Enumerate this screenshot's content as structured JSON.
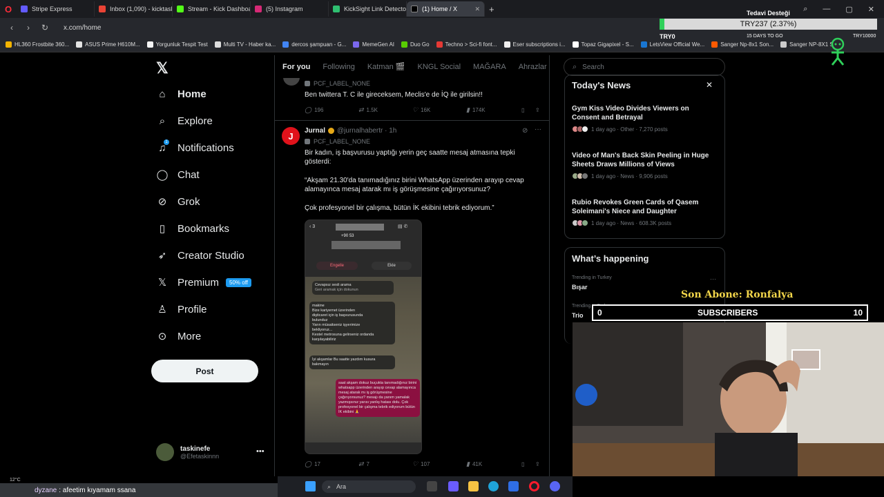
{
  "browser": {
    "tabs": [
      {
        "label": "Stripe Express",
        "color": "#635bff"
      },
      {
        "label": "Inbox (1,090) - kicktaskine",
        "color": "#ea4335"
      },
      {
        "label": "Stream - Kick Dashboard",
        "color": "#53fc18"
      },
      {
        "label": "(5) Instagram",
        "color": "#d62976"
      },
      {
        "label": "KickSight Link Detector",
        "color": "#2fbf71"
      },
      {
        "label": "(1) Home / X",
        "color": "#000000",
        "active": true
      }
    ],
    "url": "x.com/home",
    "bookmarks": [
      {
        "label": "HL360 Frostbite 360...",
        "color": "#f4b400"
      },
      {
        "label": "ASUS Prime H610M...",
        "color": "#e4e4e4"
      },
      {
        "label": "Yorgunluk Tespit Test",
        "color": "#f4f4f4"
      },
      {
        "label": "Multi TV - Haber ka...",
        "color": "#dddddd"
      },
      {
        "label": "dercos şampuan - G...",
        "color": "#4285f4"
      },
      {
        "label": "MemeGen AI",
        "color": "#7b68ee"
      },
      {
        "label": "Duo Go",
        "color": "#58cc02"
      },
      {
        "label": "Techno > Sci-fi font...",
        "color": "#e53935"
      },
      {
        "label": "Eser subscriptions i...",
        "color": "#f0f0f0"
      },
      {
        "label": "Topaz Gigapixel - S...",
        "color": "#ffffff"
      },
      {
        "label": "LetsView Official We...",
        "color": "#1976d2"
      },
      {
        "label": "Sanger Np-8x1 Son...",
        "color": "#ff5a00"
      },
      {
        "label": "Sanger NP-8X1 S",
        "color": "#cccccc"
      }
    ]
  },
  "x": {
    "nav": [
      {
        "label": "Home",
        "icon": "home-icon",
        "glyph": "⌂",
        "bold": true
      },
      {
        "label": "Explore",
        "icon": "search-icon",
        "glyph": "⌕"
      },
      {
        "label": "Notifications",
        "icon": "bell-icon",
        "glyph": "♫"
      },
      {
        "label": "Chat",
        "icon": "chat-icon",
        "glyph": "◯"
      },
      {
        "label": "Grok",
        "icon": "grok-icon",
        "glyph": "⊘"
      },
      {
        "label": "Bookmarks",
        "icon": "bookmark-icon",
        "glyph": "▯"
      },
      {
        "label": "Creator Studio",
        "icon": "rocket-icon",
        "glyph": "➶"
      },
      {
        "label": "Premium",
        "icon": "x-logo-icon",
        "glyph": "𝕏"
      },
      {
        "label": "Profile",
        "icon": "person-icon",
        "glyph": "♙"
      },
      {
        "label": "More",
        "icon": "more-circle-icon",
        "glyph": "⊙"
      }
    ],
    "premium_badge": "50% off",
    "notification_count": "1",
    "post_button": "Post",
    "account": {
      "name": "taskinefe",
      "handle": "@Efetaskinnn"
    },
    "timeline_tabs": [
      "For you",
      "Following",
      "Katman 🎬",
      "KNGL Social",
      "MAĞARA",
      "Ahrazlar"
    ],
    "prev_post": {
      "label": "PCF_LABEL_NONE",
      "text": "Ben twittera T. C ile gireceksem, Meclis'e de İQ ile girilsin!!",
      "replies": "196",
      "reposts": "1.5K",
      "likes": "16K",
      "views": "174K"
    },
    "post": {
      "avatar_letter": "J",
      "author": "Jurnal",
      "handle": "@jurnalhabertr · 1h",
      "label": "PCF_LABEL_NONE",
      "text1": "Bir kadın, iş başvurusu yaptığı yerin geç saatte mesaj atmasına tepki gösterdi:",
      "text2": "“Akşam 21.30'da tanımadığınız birini WhatsApp üzerinden arayıp cevap alamayınca mesaj atarak mı iş görüşmesine çağırıyorsunuz?",
      "text3": "Çok profesyonel bir çalışma, bütün İK ekibini tebrik ediyorum.”",
      "image": {
        "phone": "+90 53",
        "block": "Engelle",
        "add": "Ekle",
        "missed": "Cevapsız sesli arama",
        "missed_sub": "Geri aramak için dokunun",
        "msg1": "makine\nBize kariyernet üzerinden\n dişticaret için iş başvurusunda\nbulunduz\nYarın müsaitseniz işyerimize\nbekliyoruz...\nKestel metrosuna gelirseniz ordanda\nkarşılayabiliriz",
        "msg2": "İyi akşamlar\nBu saatte yazdım kusura bakmayın",
        "msg3": "saat akşam dokuz buçukta tanımadığınız birini whatsapp üzerinden arayıp cevap alamayınca mesaj atarak mı iş görüşmesine çağırıyorsunuz? mesajı da yanım yamalak yazmışsınız yarısı yanlış hatası dolu. Çok profesyonel bir çalışma tebrik ediyorum bütün İK ekibini 🙏"
      },
      "replies": "17",
      "reposts": "7",
      "likes": "107",
      "views": "41K"
    },
    "search_placeholder": "Search",
    "news_title": "Today's News",
    "news": [
      {
        "title": "Gym Kiss Video Divides Viewers on Consent and Betrayal",
        "meta": "1 day ago · Other · 7,270 posts"
      },
      {
        "title": "Video of Man's Back Skin Peeling in Huge Sheets Draws Millions of Views",
        "meta": "1 day ago · News · 9,906 posts"
      },
      {
        "title": "Rubio Revokes Green Cards of Qasem Soleimani's Niece and Daughter",
        "meta": "1 day ago · News · 608.3K posts"
      }
    ],
    "happening_title": "What’s happening",
    "trends": [
      {
        "label": "Trending in Turkey",
        "name": "Bışar"
      },
      {
        "label": "Trending in Turkey",
        "name": "Trio"
      }
    ]
  },
  "overlay": {
    "donation_title": "Tedavi Desteği",
    "donation_value": "TRY237 (2.37%)",
    "donation_fraction": 0.0237,
    "donation_low": "TRY0",
    "donation_days": "15 DAYS TO GO",
    "donation_goal": "TRY10000",
    "last_sub": "Son Abone: Ronfalya",
    "subs_left": "0",
    "subs_label": "SUBSCRIBERS",
    "subs_right": "10"
  },
  "chat": {
    "user": "dyzane",
    "message": ": afeetim kıyamam ssana"
  },
  "taskbar": {
    "search": "Ara",
    "weather": "12°C"
  }
}
